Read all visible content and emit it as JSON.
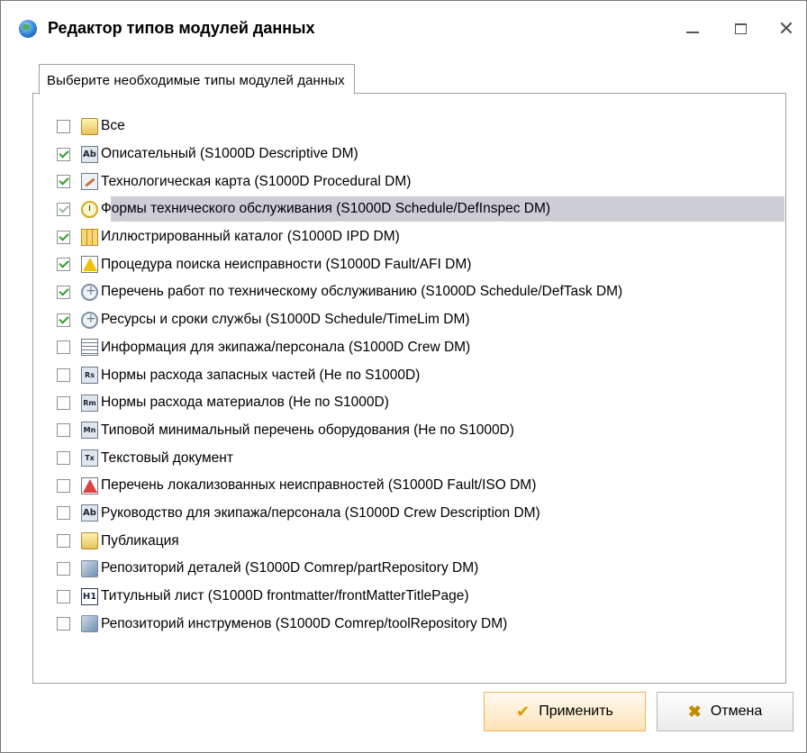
{
  "window": {
    "title": "Редактор типов модулей данных",
    "controls": {
      "minimize": "minimize",
      "maximize": "maximize",
      "close": "✕"
    }
  },
  "tab": {
    "label": "Выберите необходимые типы модулей данных"
  },
  "items": [
    {
      "label": "Все",
      "checked": false,
      "icon": "folder-icon"
    },
    {
      "label": "Описательный (S1000D Descriptive DM)",
      "checked": true,
      "icon": "ab-icon",
      "icon_text": "Ab"
    },
    {
      "label": "Технологическая карта (S1000D Procedural DM)",
      "checked": true,
      "icon": "pencil-icon"
    },
    {
      "label": "Формы технического обслуживания (S1000D Schedule/DefInspec DM)",
      "checked": true,
      "selected": true,
      "disabled": true,
      "icon": "clock-icon"
    },
    {
      "label": "Иллюстрированный каталог (S1000D IPD DM)",
      "checked": true,
      "icon": "grid-icon"
    },
    {
      "label": "Процедура поиска неисправности (S1000D Fault/AFI DM)",
      "checked": true,
      "icon": "warning-icon"
    },
    {
      "label": "Перечень работ по техническому обслуживанию (S1000D Schedule/DefTask DM)",
      "checked": true,
      "icon": "gear-icon"
    },
    {
      "label": "Ресурсы и сроки службы (S1000D Schedule/TimeLim DM)",
      "checked": true,
      "icon": "gear-icon"
    },
    {
      "label": "Информация для экипажа/персонала (S1000D Crew DM)",
      "checked": false,
      "icon": "list-icon"
    },
    {
      "label": "Нормы расхода запасных частей (Не по S1000D)",
      "checked": false,
      "icon": "rs-icon",
      "icon_text": "Rs"
    },
    {
      "label": "Нормы расхода материалов (Не по S1000D)",
      "checked": false,
      "icon": "rm-icon",
      "icon_text": "Rm"
    },
    {
      "label": "Типовой минимальный перечень оборудования (Не по S1000D)",
      "checked": false,
      "icon": "mn-icon",
      "icon_text": "Mn"
    },
    {
      "label": "Текстовый документ",
      "checked": false,
      "icon": "tx-icon",
      "icon_text": "Tx"
    },
    {
      "label": "Перечень локализованных неисправностей (S1000D Fault/ISO DM)",
      "checked": false,
      "icon": "red-warning-icon"
    },
    {
      "label": "Руководство для экипажа/персонала (S1000D Crew Description DM)",
      "checked": false,
      "icon": "ab-icon",
      "icon_text": "Ab"
    },
    {
      "label": "Публикация",
      "checked": false,
      "icon": "folder-icon"
    },
    {
      "label": "Репозиторий деталей (S1000D Comrep/partRepository DM)",
      "checked": false,
      "icon": "repository-icon"
    },
    {
      "label": "Титульный лист (S1000D frontmatter/frontMatterTitlePage)",
      "checked": false,
      "icon": "h1-icon",
      "icon_text": "H1"
    },
    {
      "label": "Репозиторий инструменов (S1000D Comrep/toolRepository DM)",
      "checked": false,
      "icon": "repository-icon"
    }
  ],
  "buttons": {
    "apply": "Применить",
    "cancel": "Отмена"
  },
  "colors": {
    "selection": "#cdcdd6",
    "check": "#2aa02a",
    "apply_border": "#f0b256"
  }
}
